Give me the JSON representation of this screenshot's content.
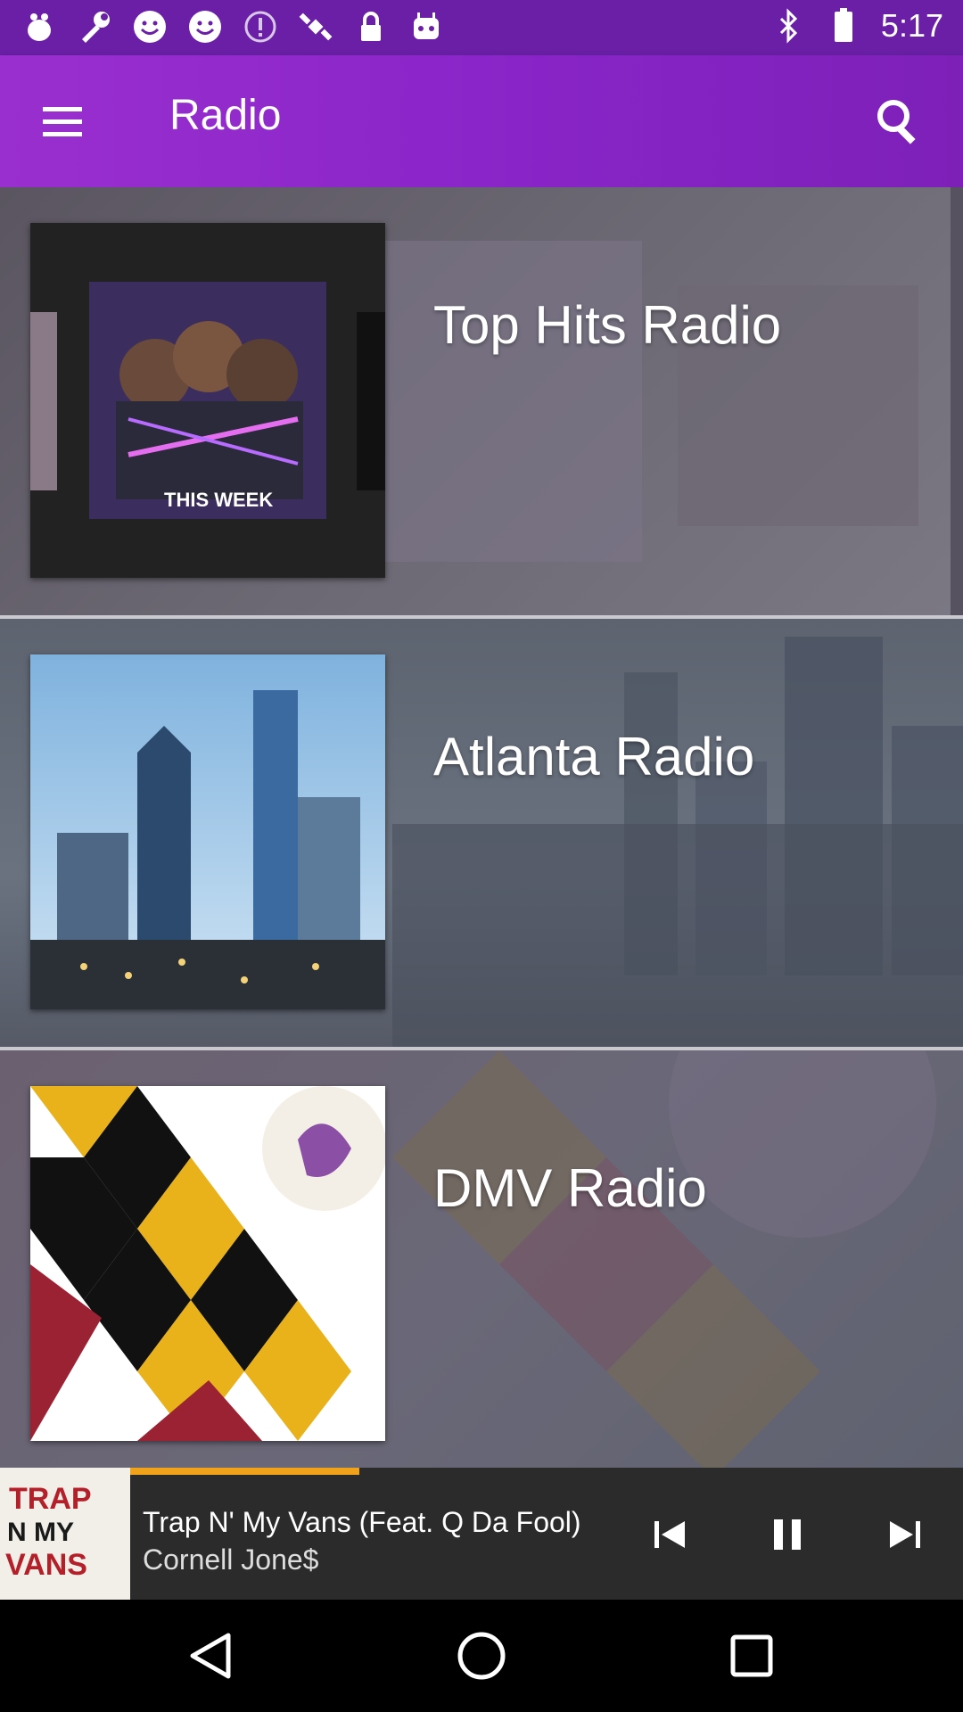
{
  "app": {
    "title": "Radio",
    "accent": "#8a25c9"
  },
  "status_bar": {
    "time": "5:17",
    "icons": [
      "bug-icon",
      "wrench-icon",
      "smiley-icon",
      "smiley-icon",
      "alert-icon",
      "satellite-icon",
      "lock-icon",
      "robot-icon"
    ],
    "right_icons": [
      "bluetooth-icon",
      "battery-icon"
    ]
  },
  "stations": [
    {
      "name": "Top Hits Radio",
      "thumb_icon": "album-cover"
    },
    {
      "name": "Atlanta Radio",
      "thumb_icon": "city-skyline"
    },
    {
      "name": "DMV Radio",
      "thumb_icon": "maryland-flag"
    }
  ],
  "now_playing": {
    "title": "Trap N' My Vans (Feat. Q Da Fool)",
    "artist": "Cornell Jone$",
    "progress_fraction": 0.275,
    "art_text": "TRAP N MY VANS"
  },
  "nav": {
    "back": "back-icon",
    "home": "home-icon",
    "recents": "recents-icon"
  }
}
